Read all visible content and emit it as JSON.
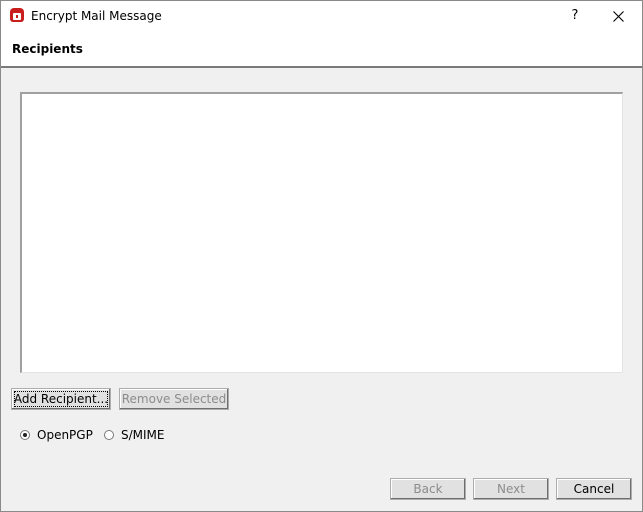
{
  "window": {
    "title": "Encrypt Mail Message",
    "help_label": "?",
    "icons": {
      "app": "kleopatra-app-icon",
      "close": "close-icon"
    }
  },
  "header": {
    "title": "Recipients"
  },
  "recipients": {
    "items": []
  },
  "actions": {
    "add_recipient": "Add Recipient...",
    "remove_selected": "Remove Selected"
  },
  "protocol": {
    "options": [
      {
        "label": "OpenPGP",
        "selected": true
      },
      {
        "label": "S/MIME",
        "selected": false
      }
    ]
  },
  "footer": {
    "back": "Back",
    "next": "Next",
    "cancel": "Cancel"
  }
}
